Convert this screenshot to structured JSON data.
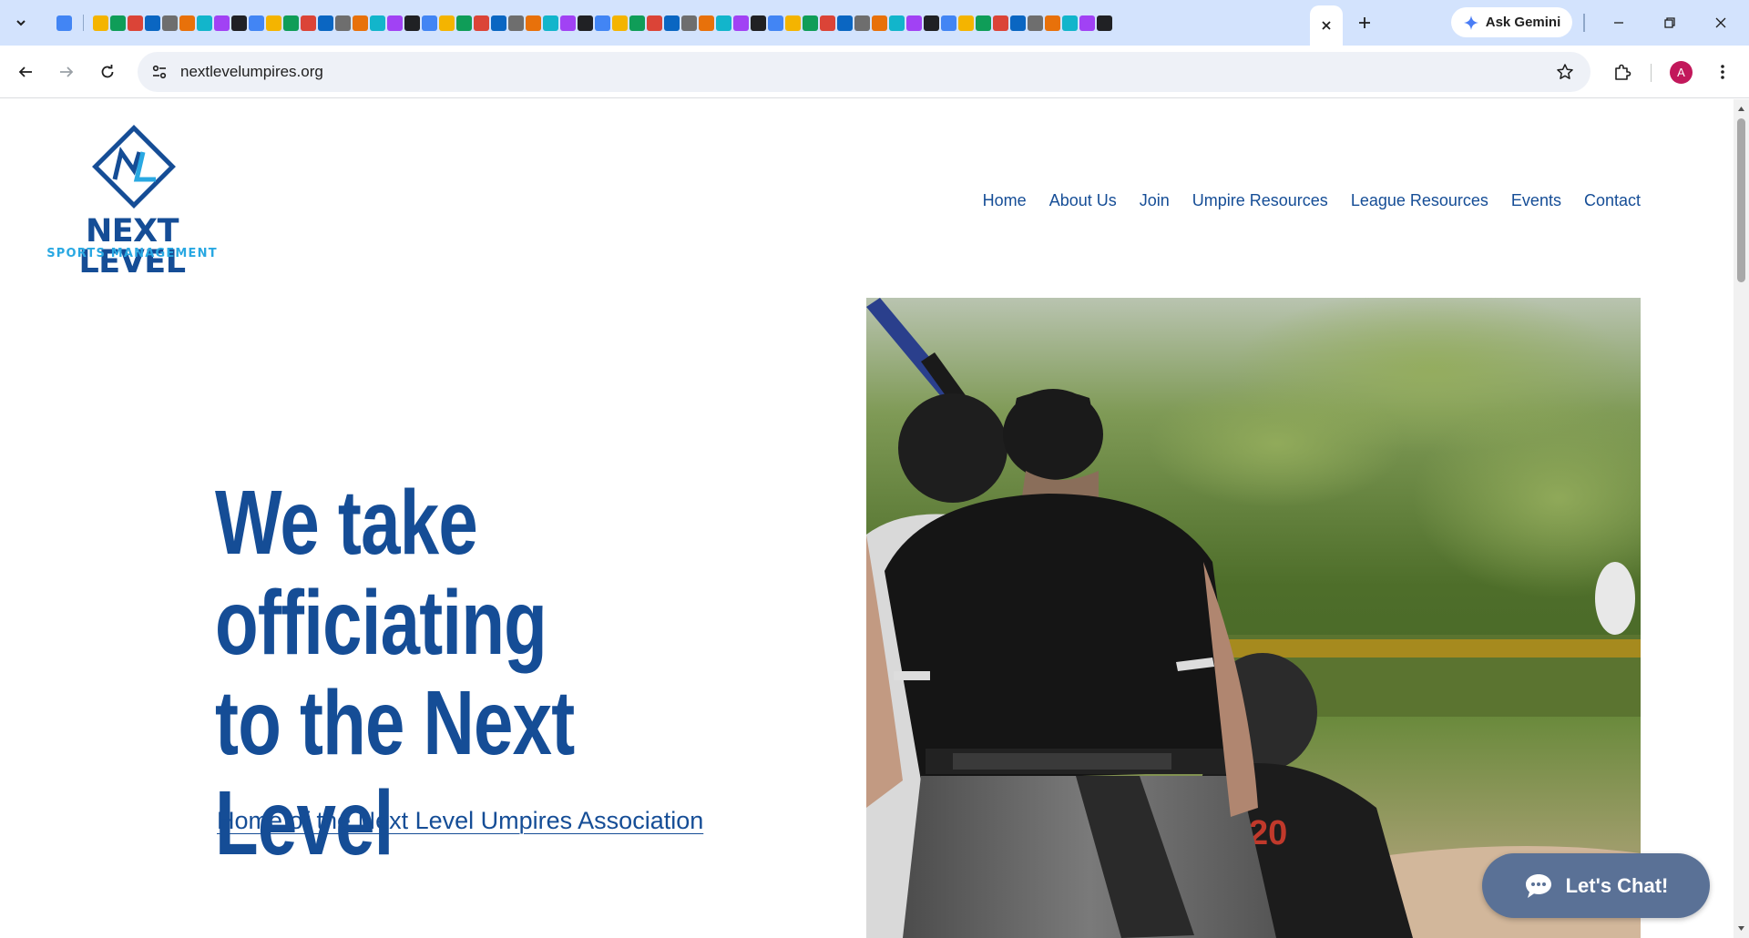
{
  "browser": {
    "tab_icons": [
      "google-docs-icon",
      "folder-icon",
      "green-tab-icon",
      "gmail-icon",
      "green-tab-icon",
      "green-tab-icon",
      "globe-icon",
      "globe-icon",
      "orange-bookmark-icon",
      "blue-circle-icon",
      "shield-icon",
      "linkedin-icon",
      "linkedin-icon",
      "d-icon",
      "green-tab-icon",
      "maps-icon",
      "google-icon",
      "mail-icon",
      "dark-icon",
      "green-icon",
      "openai-icon",
      "docs-icon",
      "yellow-icon",
      "docs-icon",
      "dark-icon",
      "docs-icon",
      "google-icon",
      "medium-icon",
      "orange-icon",
      "orange-icon",
      "blue-icon",
      "shield-icon",
      "close-icon",
      "teal-icon",
      "docs-icon",
      "s-icon",
      "uk-icon",
      "google-icon",
      "starburst-icon",
      "shield-icon",
      "docs-icon",
      "s-icon",
      "wave-icon",
      "github-icon",
      "google-icon",
      "globe-icon",
      "docs-icon",
      "reddit-icon",
      "google-icon",
      "google-icon",
      "red-icon",
      "cloud-icon",
      "docs-icon",
      "red-icon",
      "docs-icon",
      "green-icon",
      "green-icon",
      "linkedin-icon",
      "s-icon",
      "google-icon"
    ],
    "ask_gemini_label": "Ask Gemini",
    "url": "nextlevelumpires.org",
    "profile_initial": "A"
  },
  "site": {
    "logo": {
      "monogram": "NL",
      "title": "NEXT LEVEL",
      "subtitle": "SPORTS MANAGEMENT"
    },
    "nav": [
      {
        "label": "Home"
      },
      {
        "label": "About Us"
      },
      {
        "label": "Join"
      },
      {
        "label": "Umpire Resources"
      },
      {
        "label": "League Resources"
      },
      {
        "label": "Events"
      },
      {
        "label": "Contact"
      }
    ],
    "hero": {
      "title": "We take officiating to the Next Level",
      "link": "Home of the Next Level Umpires Association"
    },
    "chat": {
      "label": "Let's Chat!"
    }
  },
  "colors": {
    "brand_blue": "#154d96",
    "brand_light_blue": "#29a8e2",
    "chat_bg": "#5a7196",
    "tabstrip_bg": "#d3e3fd"
  }
}
